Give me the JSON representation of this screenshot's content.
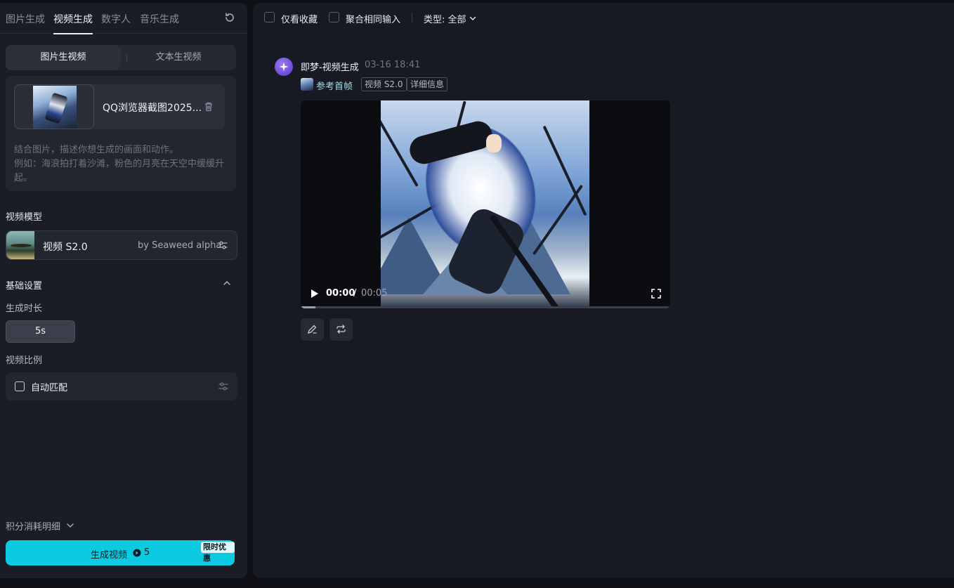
{
  "left_panel": {
    "tabs": [
      "图片生成",
      "视频生成",
      "数字人",
      "音乐生成"
    ],
    "active_tab": "视频生成",
    "mode_tabs": {
      "image_to_video": "图片生视频",
      "text_to_video": "文本生视频"
    },
    "upload": {
      "file_name": "QQ浏览器截图2025...",
      "hint_line1": "结合图片，描述你想生成的画面和动作。",
      "hint_line2": "例如：海浪拍打着沙滩，粉色的月亮在天空中缓缓升起。"
    },
    "model_section_label": "视频模型",
    "model": {
      "name": "视频 S2.0",
      "by": "by Seaweed alpha"
    },
    "basic_settings_label": "基础设置",
    "duration_label": "生成时长",
    "duration_value": "5s",
    "ratio_label": "视频比例",
    "ratio_value": "自动匹配",
    "credits_label": "积分消耗明细",
    "generate_button": {
      "label": "生成视频",
      "cost": "5",
      "promo": "限时优惠"
    },
    "accent_color": "#0ccbe0"
  },
  "right_panel": {
    "filters": {
      "favorites_only": "仅看收藏",
      "aggregate_inputs": "聚合相同输入",
      "type_filter": "类型: 全部"
    },
    "record": {
      "author": "即梦-视频生成",
      "time": "03-16  18:41",
      "ref_label": "参考首帧",
      "tags": [
        "视频 S2.0",
        "详细信息"
      ],
      "video": {
        "current_time": "00:00",
        "separator": "/",
        "duration": "00:05",
        "progress": 0.04
      }
    }
  }
}
